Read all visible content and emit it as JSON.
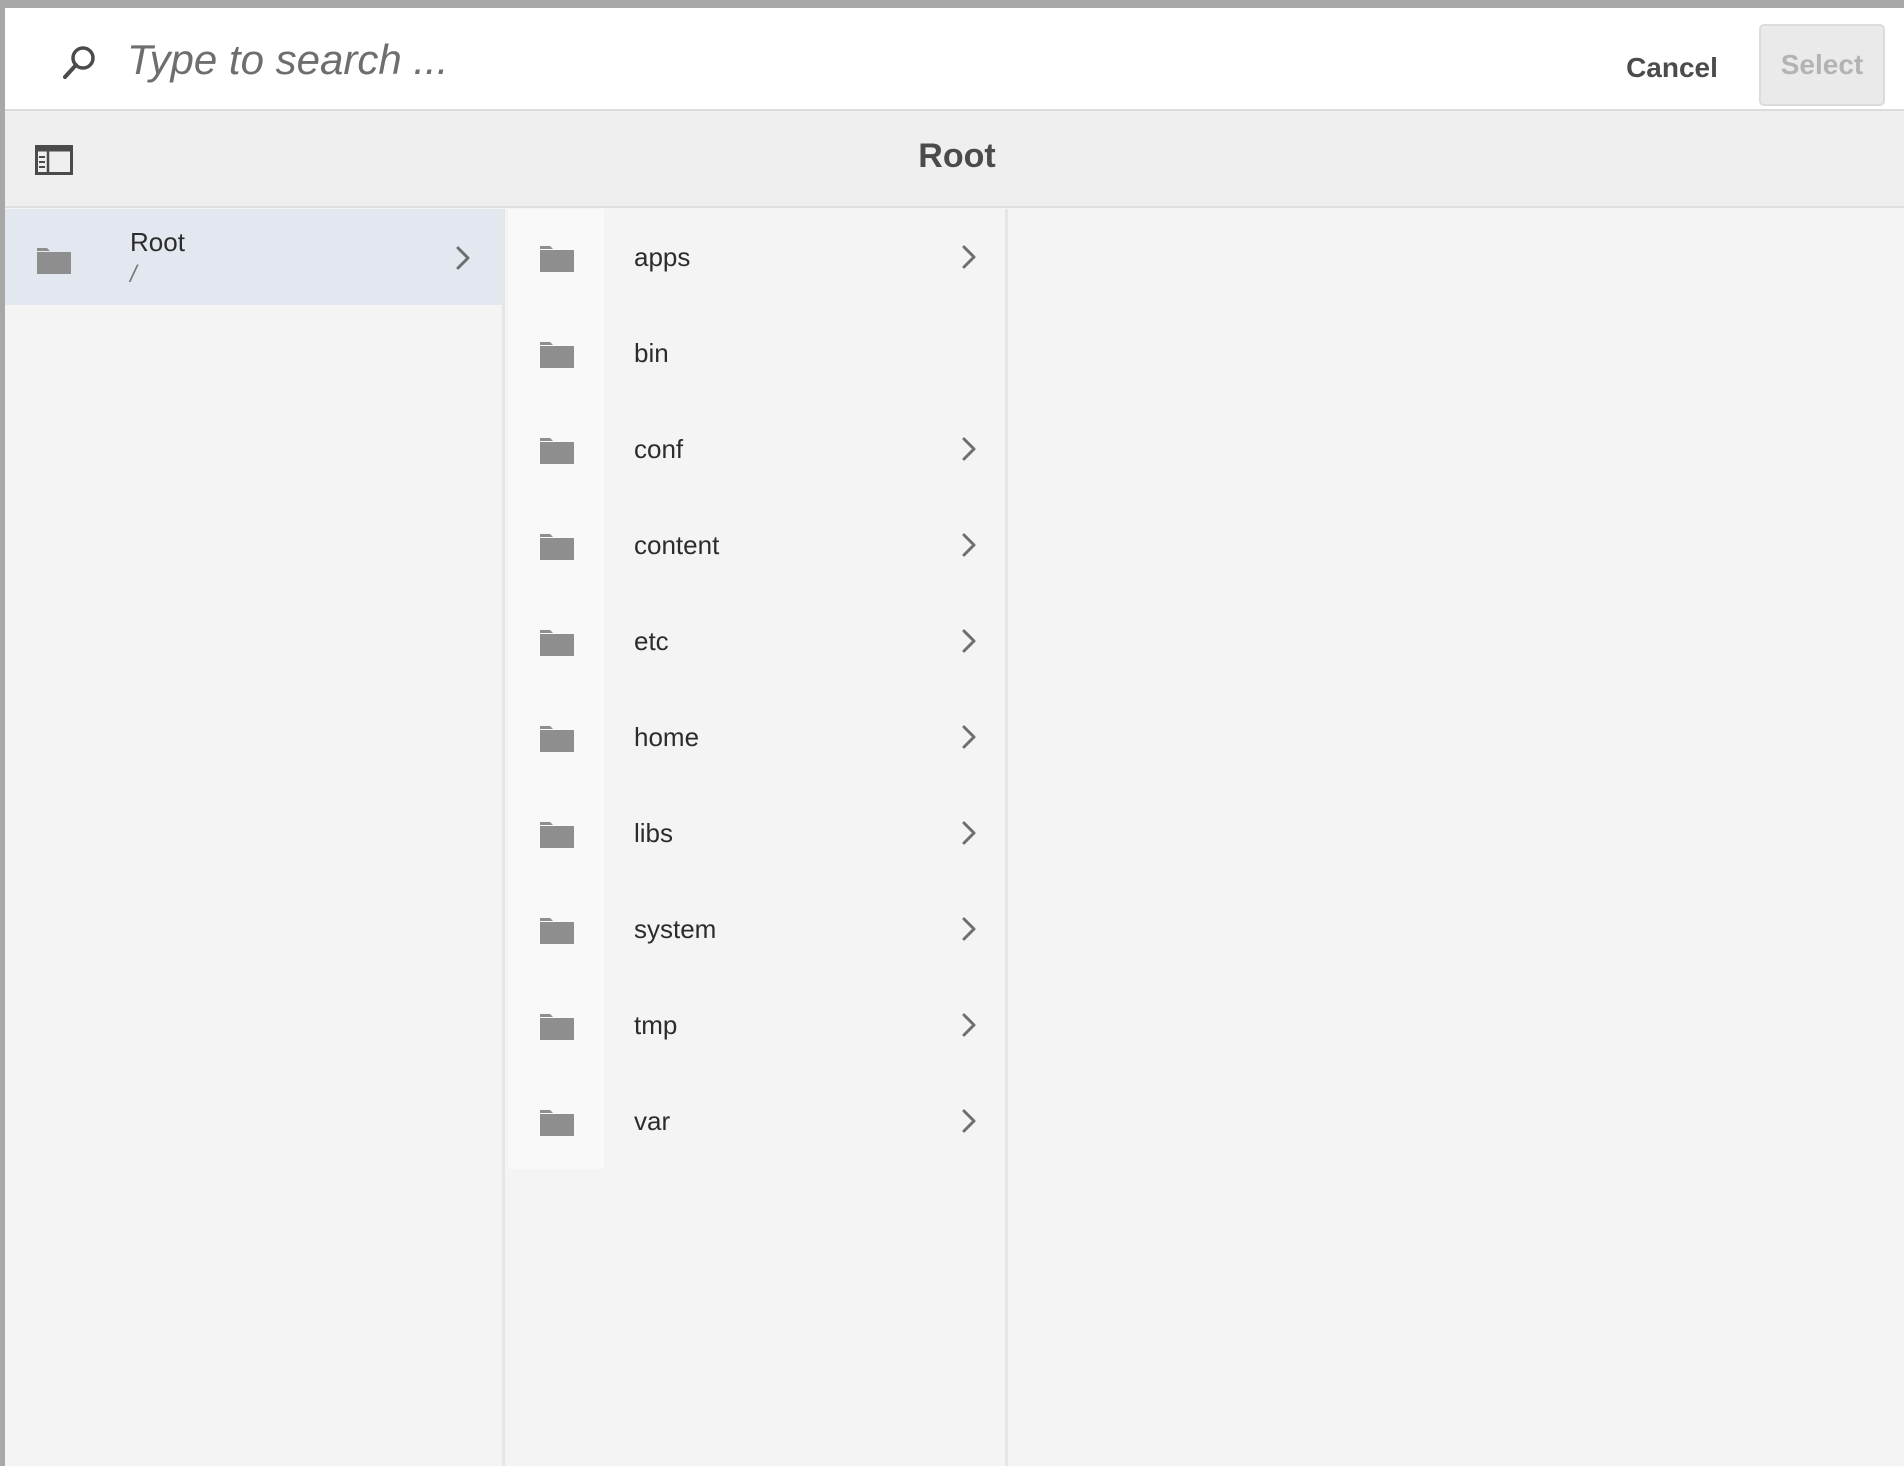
{
  "search": {
    "placeholder": "Type to search ..."
  },
  "actions": {
    "cancel_label": "Cancel",
    "select_label": "Select"
  },
  "header": {
    "title": "Root"
  },
  "column1": {
    "items": [
      {
        "label": "Root",
        "path": "/",
        "selected": true,
        "has_children": true
      }
    ]
  },
  "column2": {
    "items": [
      {
        "label": "apps",
        "has_children": true
      },
      {
        "label": "bin",
        "has_children": false
      },
      {
        "label": "conf",
        "has_children": true
      },
      {
        "label": "content",
        "has_children": true
      },
      {
        "label": "etc",
        "has_children": true
      },
      {
        "label": "home",
        "has_children": true
      },
      {
        "label": "libs",
        "has_children": true
      },
      {
        "label": "system",
        "has_children": true
      },
      {
        "label": "tmp",
        "has_children": true
      },
      {
        "label": "var",
        "has_children": true
      }
    ]
  },
  "colors": {
    "selected_row": "#e3e8f0",
    "folder_icon": "#8e8e8e",
    "chevron": "#6e6e6e",
    "text": "#2c2c2c"
  }
}
